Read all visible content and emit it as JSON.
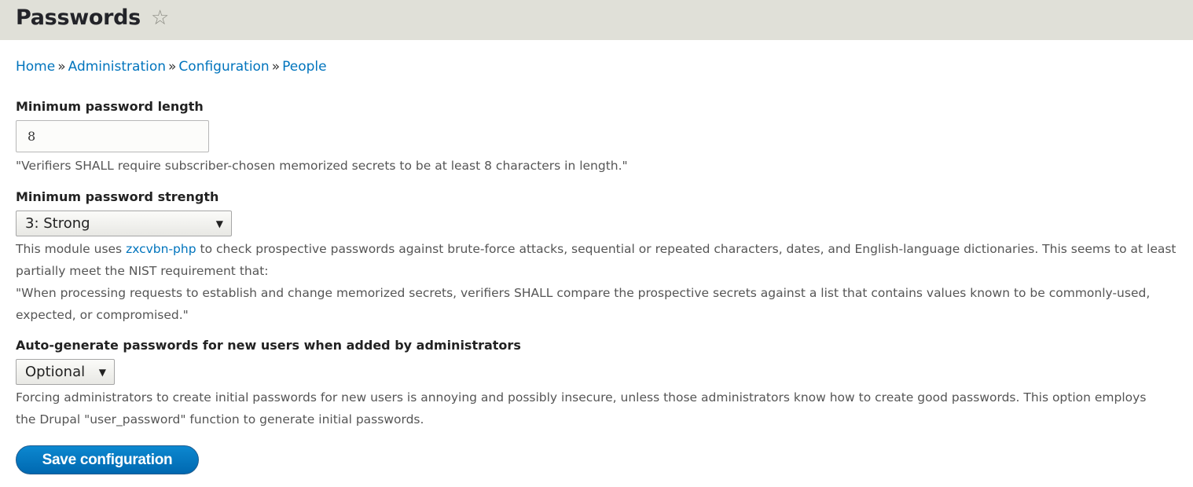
{
  "header": {
    "title": "Passwords",
    "star_icon": "star-outline-icon"
  },
  "breadcrumb": {
    "items": [
      "Home",
      "Administration",
      "Configuration",
      "People"
    ],
    "separator": "»"
  },
  "min_length": {
    "label": "Minimum password length",
    "value": "8",
    "description": "\"Verifiers SHALL require subscriber-chosen memorized secrets to be at least 8 characters in length.\""
  },
  "min_strength": {
    "label": "Minimum password strength",
    "selected": "3: Strong",
    "description_pre": "This module uses ",
    "description_link": "zxcvbn-php",
    "description_post": " to check prospective passwords against brute-force attacks, sequential or repeated characters, dates, and English-language dictionaries. This seems to at least partially meet the NIST requirement that:",
    "quote": "\"When processing requests to establish and change memorized secrets, verifiers SHALL compare the prospective secrets against a list that contains values known to be commonly-used, expected, or compromised.\""
  },
  "auto_generate": {
    "label": "Auto-generate passwords for new users when added by administrators",
    "selected": "Optional",
    "description": "Forcing administrators to create initial passwords for new users is annoying and possibly insecure, unless those administrators know how to create good passwords. This option employs the Drupal \"user_password\" function to generate initial passwords."
  },
  "actions": {
    "save_label": "Save configuration"
  },
  "colors": {
    "link": "#0074bd",
    "header_bg": "#e0e0d8",
    "primary_button": "#0074bd"
  }
}
